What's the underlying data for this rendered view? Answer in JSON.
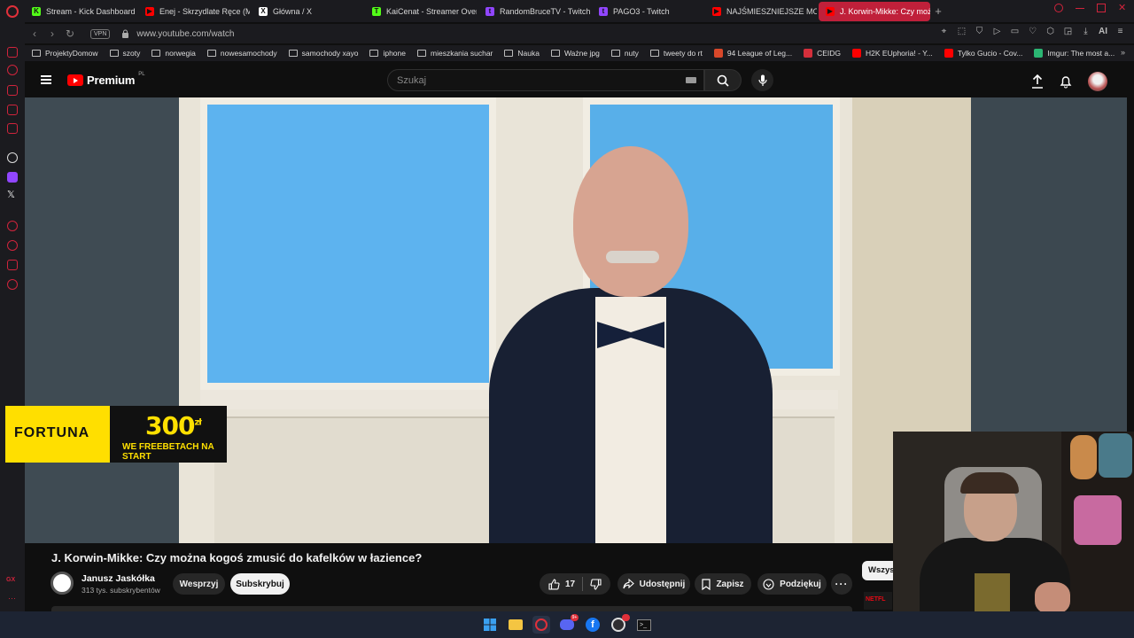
{
  "browser": {
    "tabs": [
      {
        "label": "Stream - Kick Dashboard",
        "color": "#53fc18",
        "glyph": "K"
      },
      {
        "label": "Enej - Skrzydlate Ręce (M",
        "color": "#ff0000",
        "glyph": "▶"
      },
      {
        "label": "Główna / X",
        "color": "#ffffff",
        "glyph": "X"
      },
      {
        "label": "KaiCenat - Streamer Over",
        "color": "#53fc18",
        "glyph": "T"
      },
      {
        "label": "RandomBruceTV - Twitch",
        "color": "#9146ff",
        "glyph": "t"
      },
      {
        "label": "PAGO3 - Twitch",
        "color": "#9146ff",
        "glyph": "t"
      },
      {
        "label": "NAJŚMIESZNIEJSZE MOM",
        "color": "#ff0000",
        "glyph": "▶"
      },
      {
        "label": "J. Korwin-Mikke: Czy moż",
        "color": "#ff0000",
        "glyph": "▶",
        "active": true
      }
    ],
    "vpn_label": "VPN",
    "url": "www.youtube.com/watch",
    "ai_label": "AI",
    "bookmarks": [
      {
        "label": "ProjektyDomow",
        "type": "folder"
      },
      {
        "label": "szoty",
        "type": "folder"
      },
      {
        "label": "norwegia",
        "type": "folder"
      },
      {
        "label": "nowesamochody",
        "type": "folder"
      },
      {
        "label": "samochody xayo",
        "type": "folder"
      },
      {
        "label": "iphone",
        "type": "folder"
      },
      {
        "label": "mieszkania suchar",
        "type": "folder"
      },
      {
        "label": "Nauka",
        "type": "folder"
      },
      {
        "label": "Ważne jpg",
        "type": "folder"
      },
      {
        "label": "nuty",
        "type": "folder"
      },
      {
        "label": "tweety do rt",
        "type": "folder"
      },
      {
        "label": "94 League of Leg...",
        "type": "site",
        "color": "#d8482a"
      },
      {
        "label": "CEIDG",
        "type": "site",
        "color": "#d42f3b"
      },
      {
        "label": "H2K EUphoria! - Y...",
        "type": "site",
        "color": "#ff0000"
      },
      {
        "label": "Tylko Gucio - Cov...",
        "type": "site",
        "color": "#ff0000"
      },
      {
        "label": "Imgur: The most a...",
        "type": "site",
        "color": "#2bb673"
      }
    ]
  },
  "youtube": {
    "logo_text": "Premium",
    "logo_sup": "PL",
    "search_placeholder": "Szukaj",
    "video_title": "J. Korwin-Mikke: Czy można kogoś zmusić do kafelków w łazience?",
    "channel_name": "Janusz Jaskółka",
    "channel_subs": "313 tys. subskrybentów",
    "support_label": "Wesprzyj",
    "subscribe_label": "Subskrybuj",
    "like_count": "17",
    "share_label": "Udostępnij",
    "save_label": "Zapisz",
    "thanks_label": "Podziękuj",
    "chip_label": "Wszys"
  },
  "ad": {
    "brand": "FORTUNA",
    "amount": "300",
    "currency": "zł",
    "subtitle": "WE FREEBETACH NA START"
  },
  "colors": {
    "accent": "#ff0000",
    "opera": "#e0303a",
    "active_tab": "#c0203a",
    "ad_yellow": "#ffe000"
  }
}
